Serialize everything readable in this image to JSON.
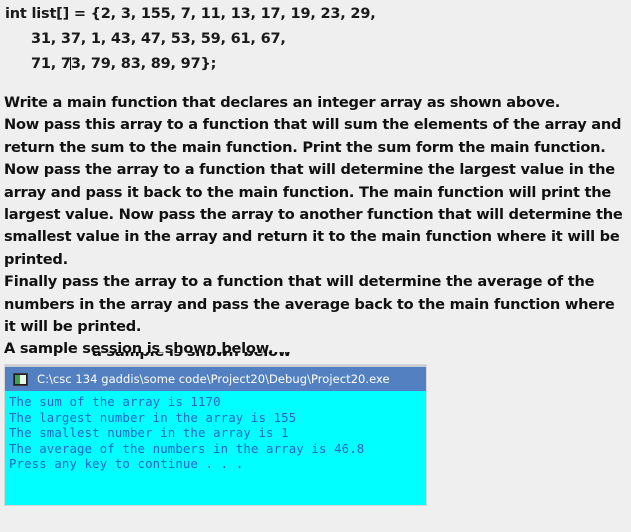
{
  "code": {
    "lines": [
      {
        "text": "int list[] = {2, 3, 155, 7, 11, 13, 17, 19, 23, 29,",
        "indent": false
      },
      {
        "text": "31, 37, 1, 43, 47, 53, 59, 61, 67,",
        "indent": true
      },
      {
        "text": "71, 73, 79, 83, 89, 97};",
        "indent": true,
        "caret_after": "71, 7"
      }
    ],
    "array_values": [
      2,
      3,
      155,
      7,
      11,
      13,
      17,
      19,
      23,
      29,
      31,
      37,
      1,
      43,
      47,
      53,
      59,
      61,
      67,
      71,
      73,
      79,
      83,
      89,
      97
    ],
    "declaration_type": "int",
    "variable_name": "list[]"
  },
  "prose": {
    "paragraphs": [
      "Write a main function that declares an integer array as shown above.",
      "Now pass this array to a function that will sum the elements of the array and return the sum to the main function. Print the sum form the main function.",
      "Now pass the array to a function that will determine the largest value in the array and pass it back to the main function.  The main function will print the largest value. Now pass the array to another function that will determine the smallest value in the array and return it to the main function where it will be printed.",
      "Finally pass the array to a function that will determine the average of the numbers in the array and pass the average back to the main function where it will be printed.",
      "A sample session is shown below."
    ],
    "obscured_fragment": "a sample is shown below"
  },
  "console": {
    "title": "C:\\csc 134 gaddis\\some code\\Project20\\Debug\\Project20.exe",
    "icon": "console-window-icon",
    "titlebar_color": "#5380c0",
    "background_color": "#00ffff",
    "text_color": "#1f66cc",
    "output_lines": [
      "The sum of the array is 1170",
      "The largest number in the array is 155",
      "The smallest number in the array is 1",
      "The average of the numbers in the array is 46.8",
      "Press any key to continue . . ."
    ],
    "results": {
      "sum": "1170",
      "largest": "155",
      "smallest": "1",
      "average": "46.8"
    }
  },
  "page": {
    "background_color": "#efefef"
  }
}
